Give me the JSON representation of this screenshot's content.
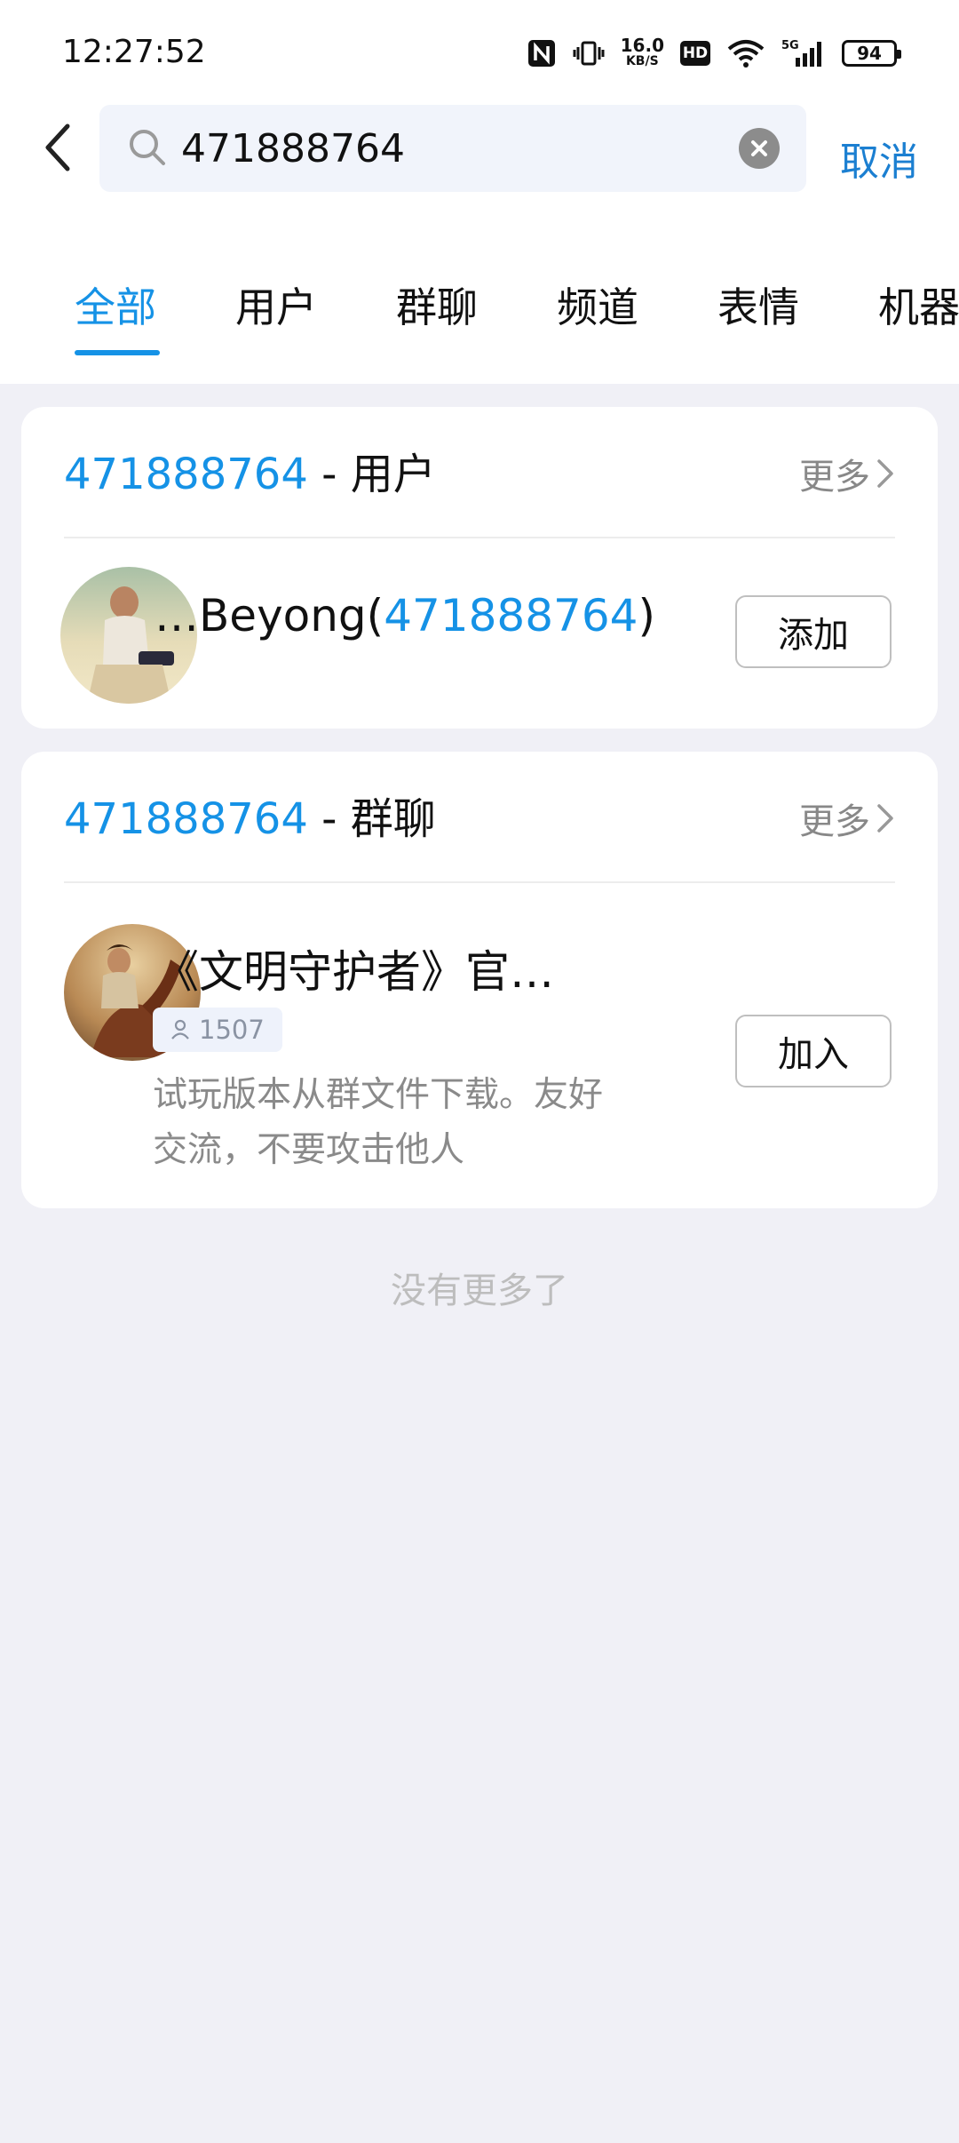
{
  "status_bar": {
    "time": "12:27:52",
    "speed_value": "16.0",
    "speed_unit": "KB/S",
    "hd_label": "HD",
    "network_label": "5G",
    "battery_level": "94"
  },
  "search": {
    "query": "471888764",
    "cancel_label": "取消"
  },
  "tabs": [
    {
      "label": "全部",
      "active": true
    },
    {
      "label": "用户",
      "active": false
    },
    {
      "label": "群聊",
      "active": false
    },
    {
      "label": "频道",
      "active": false
    },
    {
      "label": "表情",
      "active": false
    },
    {
      "label": "机器",
      "active": false
    }
  ],
  "user_section": {
    "query": "471888764",
    "suffix": " - 用户",
    "more_label": "更多",
    "result": {
      "name_prefix": "…Beyong(",
      "name_highlight": "471888764",
      "name_suffix": ")",
      "action_label": "添加"
    }
  },
  "group_section": {
    "query": "471888764",
    "suffix": " - 群聊",
    "more_label": "更多",
    "result": {
      "name": "《文明守护者》官…",
      "member_count": "1507",
      "description": "试玩版本从群文件下载。友好交流，不要攻击他人",
      "action_label": "加入"
    }
  },
  "footer": {
    "no_more": "没有更多了"
  },
  "colors": {
    "accent": "#1592e6",
    "cancel": "#1b7fd1",
    "page_bg": "#f0f0f6"
  }
}
